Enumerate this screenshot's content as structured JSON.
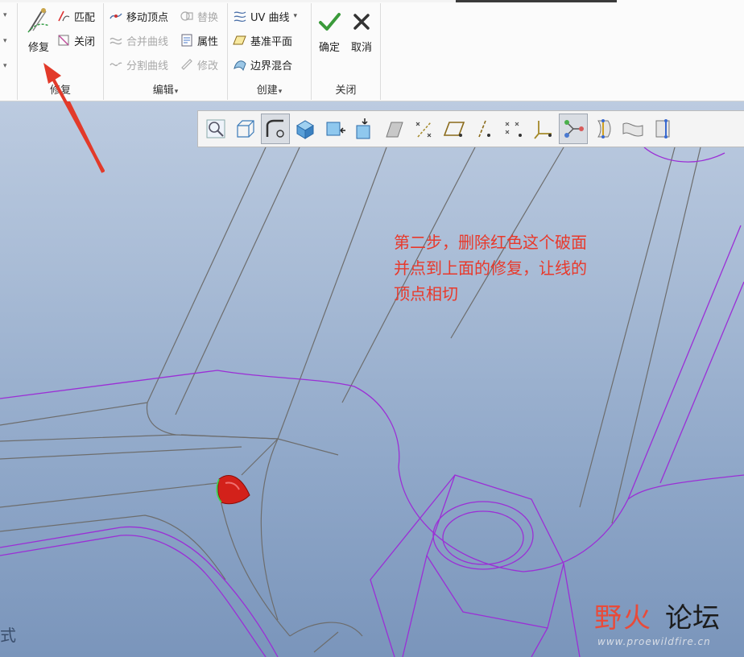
{
  "ribbon": {
    "repair_group": {
      "label": "修复",
      "repair_button": "修复",
      "match_button": "匹配",
      "close_button": "关闭"
    },
    "edit_group": {
      "label": "编辑",
      "move_vertex": "移动顶点",
      "replace": "替换",
      "merge_curves": "合并曲线",
      "properties": "属性",
      "split_curves": "分割曲线",
      "modify": "修改"
    },
    "create_group": {
      "label": "创建",
      "uv_curve": "UV 曲线",
      "datum_plane": "基准平面",
      "boundary_blend": "边界混合"
    },
    "close_group": {
      "label": "关闭",
      "ok": "确定",
      "cancel": "取消"
    }
  },
  "mini_toolbar": {
    "icons": [
      "zoom-icon",
      "display-style-icon",
      "repair-view-icon",
      "surface-display-icon",
      "cube-arrow-left-icon",
      "cube-arrow-down-icon",
      "shading-icon",
      "datum-display-icon",
      "plane-display-icon",
      "axis-display-icon",
      "point-display-icon",
      "csys-display-icon",
      "curve-node-icon",
      "edge-icon-1",
      "surface-icon",
      "edge-icon-2"
    ]
  },
  "annotation": {
    "lines": [
      "第二步，删除红色这个破面",
      "并点到上面的修复，让线的",
      "顶点相切"
    ]
  },
  "watermark": {
    "text_red": "野火",
    "text_black": "论坛",
    "url": "www.proewildfire.cn"
  },
  "corner_text": "式",
  "colors": {
    "annotation": "#e8392b",
    "ok_check": "#3a9a3a",
    "wire_purple": "#9b2fd6",
    "wire_gray": "#6d6d6d",
    "patch_red": "#d3211a"
  }
}
